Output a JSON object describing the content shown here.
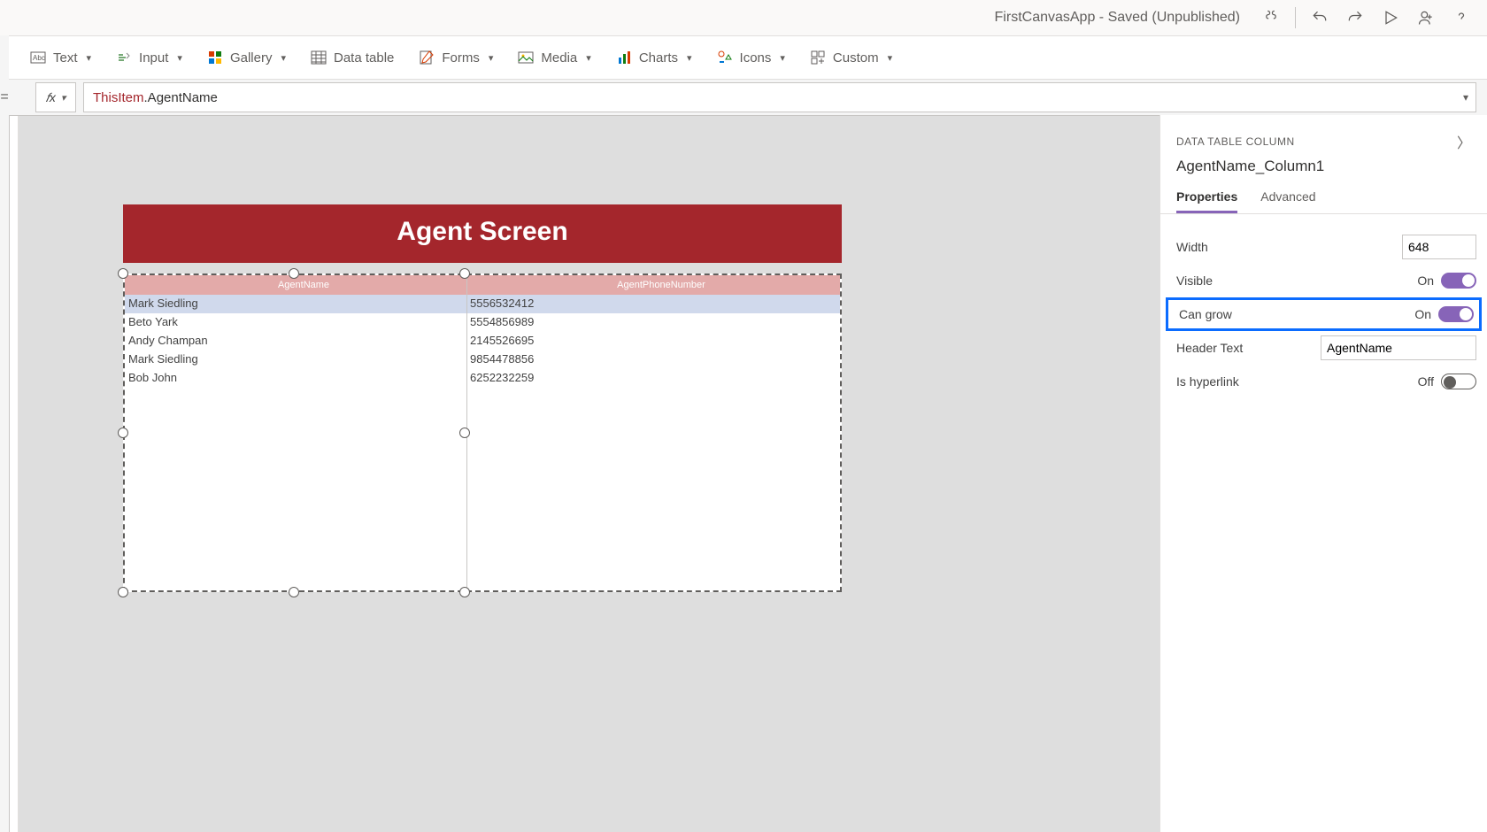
{
  "titlebar": {
    "title": "FirstCanvasApp - Saved (Unpublished)"
  },
  "ribbon": {
    "text": "Text",
    "input": "Input",
    "gallery": "Gallery",
    "datatable": "Data table",
    "forms": "Forms",
    "media": "Media",
    "charts": "Charts",
    "icons": "Icons",
    "custom": "Custom"
  },
  "formula": {
    "this": "ThisItem",
    "rest": ".AgentName"
  },
  "canvas": {
    "header": "Agent Screen",
    "columns": {
      "c1": "AgentName",
      "c2": "AgentPhoneNumber"
    },
    "rows": [
      {
        "name": "Mark Siedling",
        "phone": "5556532412"
      },
      {
        "name": "Beto Yark",
        "phone": "5554856989"
      },
      {
        "name": "Andy Champan",
        "phone": "2145526695"
      },
      {
        "name": "Mark Siedling",
        "phone": "9854478856"
      },
      {
        "name": "Bob John",
        "phone": "6252232259"
      }
    ]
  },
  "panel": {
    "section": "DATA TABLE COLUMN",
    "name": "AgentName_Column1",
    "tabs": {
      "properties": "Properties",
      "advanced": "Advanced"
    },
    "props": {
      "width_label": "Width",
      "width_value": "648",
      "visible_label": "Visible",
      "visible_state": "On",
      "cangrow_label": "Can grow",
      "cangrow_state": "On",
      "headertext_label": "Header Text",
      "headertext_value": "AgentName",
      "hyperlink_label": "Is hyperlink",
      "hyperlink_state": "Off"
    }
  }
}
